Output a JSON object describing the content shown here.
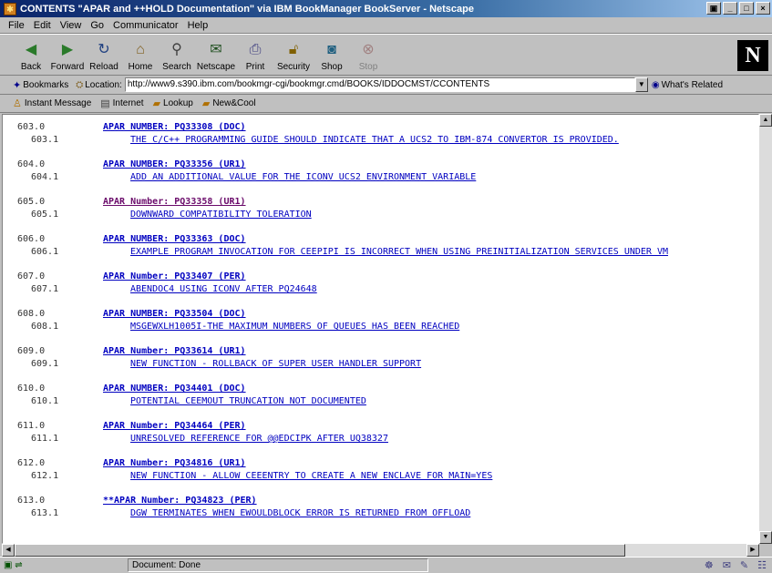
{
  "window": {
    "title": "CONTENTS \"APAR and ++HOLD Documentation\" via IBM BookManager BookServer - Netscape"
  },
  "menu": [
    "File",
    "Edit",
    "View",
    "Go",
    "Communicator",
    "Help"
  ],
  "toolbar": {
    "back": "Back",
    "forward": "Forward",
    "reload": "Reload",
    "home": "Home",
    "search": "Search",
    "netscape": "Netscape",
    "print": "Print",
    "security": "Security",
    "shop": "Shop",
    "stop": "Stop"
  },
  "location": {
    "bookmarks": "Bookmarks",
    "label": "Location:",
    "url": "http://www9.s390.ibm.com/bookmgr-cgi/bookmgr.cmd/BOOKS/IDDOCMST/CCONTENTS",
    "related": "What's Related"
  },
  "personal": {
    "instant_message": "Instant Message",
    "internet": "Internet",
    "lookup": "Lookup",
    "newcool": "New&Cool"
  },
  "entries": [
    {
      "n1": "603.0",
      "head": "APAR NUMBER: PQ33308 (DOC)",
      "n2": "603.1",
      "desc": "THE C/C++ PROGRAMMING GUIDE SHOULD INDICATE THAT A UCS2 TO IBM-874 CONVERTOR IS PROVIDED."
    },
    {
      "n1": "604.0",
      "head": "APAR NUMBER: PQ33356 (UR1)",
      "n2": "604.1",
      "desc": "ADD AN ADDITIONAL VALUE FOR THE  ICONV UCS2 ENVIRONMENT VARIABLE"
    },
    {
      "n1": "605.0",
      "head": "APAR Number: PQ33358 (UR1)",
      "n2": "605.1",
      "desc": "DOWNWARD COMPATIBILITY TOLERATION"
    },
    {
      "n1": "606.0",
      "head": "APAR NUMBER: PQ33363 (DOC)",
      "n2": "606.1",
      "desc": "EXAMPLE PROGRAM INVOCATION FOR CEEPIPI IS INCORRECT WHEN USING PREINITIALIZATION SERVICES UNDER VM"
    },
    {
      "n1": "607.0",
      "head": "APAR Number: PQ33407 (PER)",
      "n2": "607.1",
      "desc": "ABENDOC4 USING ICONV AFTER PQ24648"
    },
    {
      "n1": "608.0",
      "head": "APAR NUMBER: PQ33504 (DOC)",
      "n2": "608.1",
      "desc": "MSGEWXLH1005I-THE MAXIMUM NUMBERS OF QUEUES HAS BEEN REACHED"
    },
    {
      "n1": "609.0",
      "head": "APAR Number: PQ33614 (UR1)",
      "n2": "609.1",
      "desc": "NEW FUNCTION - ROLLBACK OF SUPER USER HANDLER SUPPORT"
    },
    {
      "n1": "610.0",
      "head": "APAR NUMBER: PQ34401 (DOC)",
      "n2": "610.1",
      "desc": "POTENTIAL CEEMOUT TRUNCATION NOT DOCUMENTED"
    },
    {
      "n1": "611.0",
      "head": "APAR Number: PQ34464 (PER)",
      "n2": "611.1",
      "desc": "UNRESOLVED REFERENCE FOR @@EDCIPK AFTER UQ38327"
    },
    {
      "n1": "612.0",
      "head": "APAR Number: PQ34816 (UR1)",
      "n2": "612.1",
      "desc": "NEW FUNCTION - ALLOW CEEENTRY TO CREATE A NEW ENCLAVE FOR MAIN=YES"
    },
    {
      "n1": "613.0",
      "head": "**APAR Number: PQ34823 (PER)",
      "n2": "613.1",
      "desc": "DGW TERMINATES WHEN EWOULDBLOCK ERROR IS RETURNED FROM OFFLOAD"
    }
  ],
  "status": {
    "text": "Document: Done"
  }
}
